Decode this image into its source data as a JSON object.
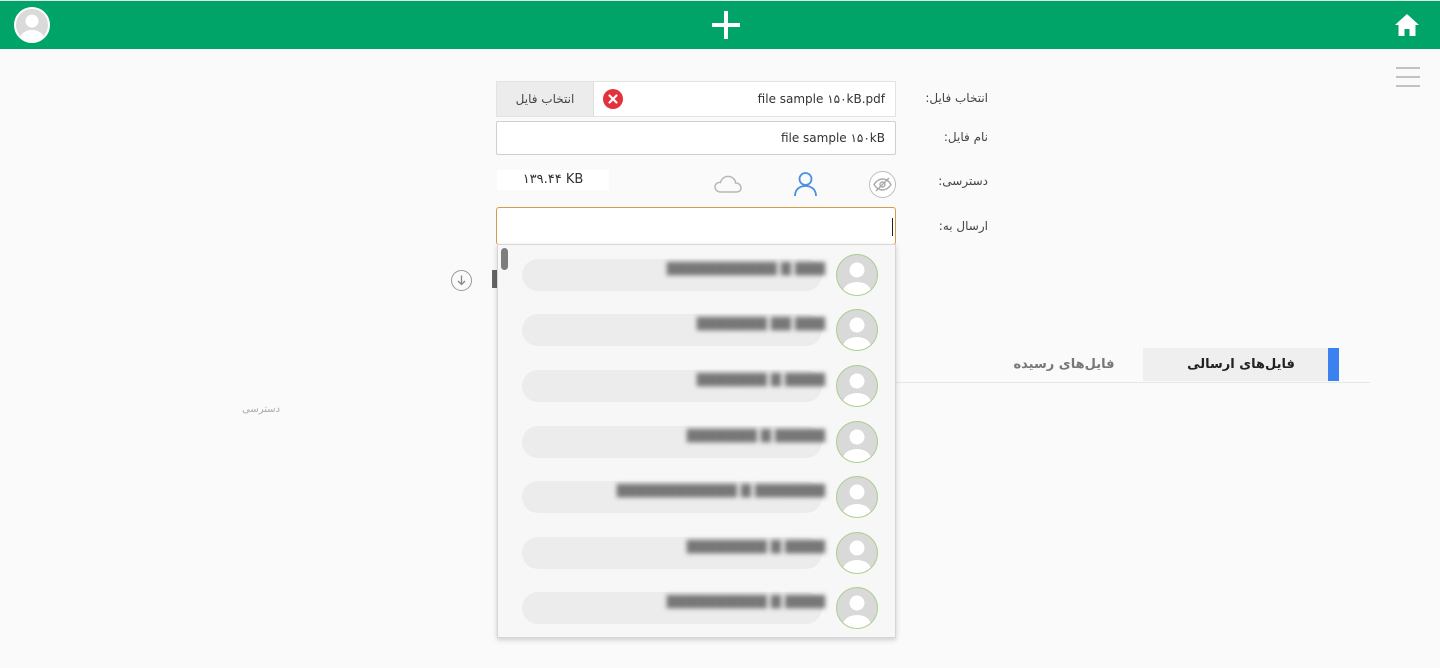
{
  "colors": {
    "header_bg": "#00a368",
    "accent_tab": "#3b82f0",
    "clear_icon": "#e2323b",
    "focus_border": "#d49a4a"
  },
  "header": {
    "home_icon": "home-icon",
    "add_icon": "plus-icon",
    "user_icon": "avatar"
  },
  "form": {
    "file_label": "انتخاب فایل:",
    "file_name_value": "file sample ۱۵۰kB.pdf",
    "choose_button": "انتخاب فایل",
    "name_label": "نام فایل:",
    "name_value": "file sample ۱۵۰kB",
    "access_label": "دسترسی:",
    "file_size": "۱۳۹.۴۴ KB",
    "send_label": "ارسال به:",
    "send_value": ""
  },
  "contacts": [
    {
      "name": "▇▇▇ ▇ ▇▇▇▇▇▇▇▇▇▇▇"
    },
    {
      "name": "▇▇▇ ▇▇ ▇▇▇▇▇▇▇"
    },
    {
      "name": "▇▇▇▇ ▇ ▇▇▇▇▇▇▇"
    },
    {
      "name": "▇▇▇▇▇ ▇ ▇▇▇▇▇▇▇"
    },
    {
      "name": "▇▇▇▇▇▇▇ ▇ ▇▇▇▇▇▇▇▇▇▇▇▇"
    },
    {
      "name": "▇▇▇▇ ▇ ▇▇▇▇▇▇▇▇"
    },
    {
      "name": "▇▇▇▇ ▇ ▇▇▇▇▇▇▇▇▇▇"
    }
  ],
  "tabs": {
    "sent": "فایل‌های ارسالی",
    "received": "فایل‌های رسیده"
  },
  "table": {
    "access_column": "دسترسی"
  }
}
